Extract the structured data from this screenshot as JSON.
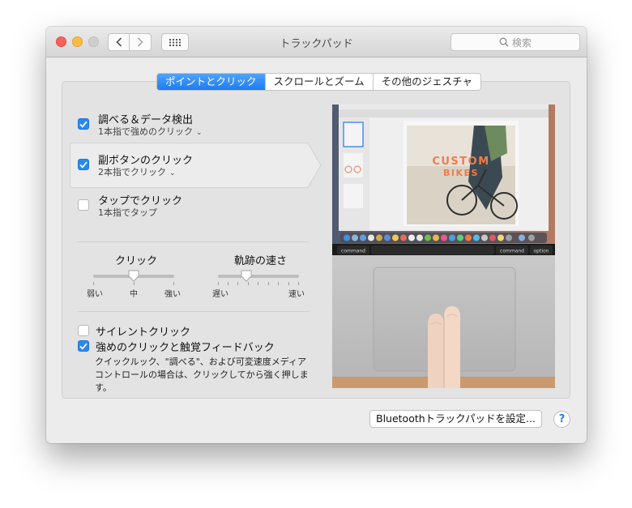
{
  "window": {
    "title": "トラックパッド"
  },
  "search": {
    "placeholder": "検索"
  },
  "tabs": [
    {
      "label": "ポイントとクリック",
      "active": true
    },
    {
      "label": "スクロールとズーム",
      "active": false
    },
    {
      "label": "その他のジェスチャ",
      "active": false
    }
  ],
  "options": [
    {
      "title": "調べる＆データ検出",
      "subtitle": "1本指で強めのクリック",
      "checked": true
    },
    {
      "title": "副ボタンのクリック",
      "subtitle": "2本指でクリック",
      "checked": true
    },
    {
      "title": "タップでクリック",
      "subtitle": "1本指でタップ",
      "checked": false
    }
  ],
  "sliders": {
    "click": {
      "label": "クリック",
      "min_label": "弱い",
      "mid_label": "中",
      "max_label": "強い",
      "value": 0.5
    },
    "tracking": {
      "label": "軌跡の速さ",
      "min_label": "遅い",
      "max_label": "速い",
      "value": 0.35
    }
  },
  "bottom_options": {
    "silent_click": {
      "label": "サイレントクリック",
      "checked": false
    },
    "force_click": {
      "label": "強めのクリックと触覚フィードバック",
      "checked": true
    },
    "description": "クイックルック、\"調べる\"、および可変速度メディアコントロールの場合は、クリックしてから強く押します。"
  },
  "preview": {
    "magazine_line1": "CUSTOM",
    "magazine_line2": "BIKES",
    "keys": [
      "command",
      "command",
      "option"
    ]
  },
  "buttons": {
    "bluetooth": "Bluetoothトラックパッドを設定...",
    "help": "?"
  },
  "colors": {
    "accent": "#2a88f5",
    "close": "#fc605c",
    "minimize": "#fdbc40",
    "zoom": "#cfcfcf"
  }
}
